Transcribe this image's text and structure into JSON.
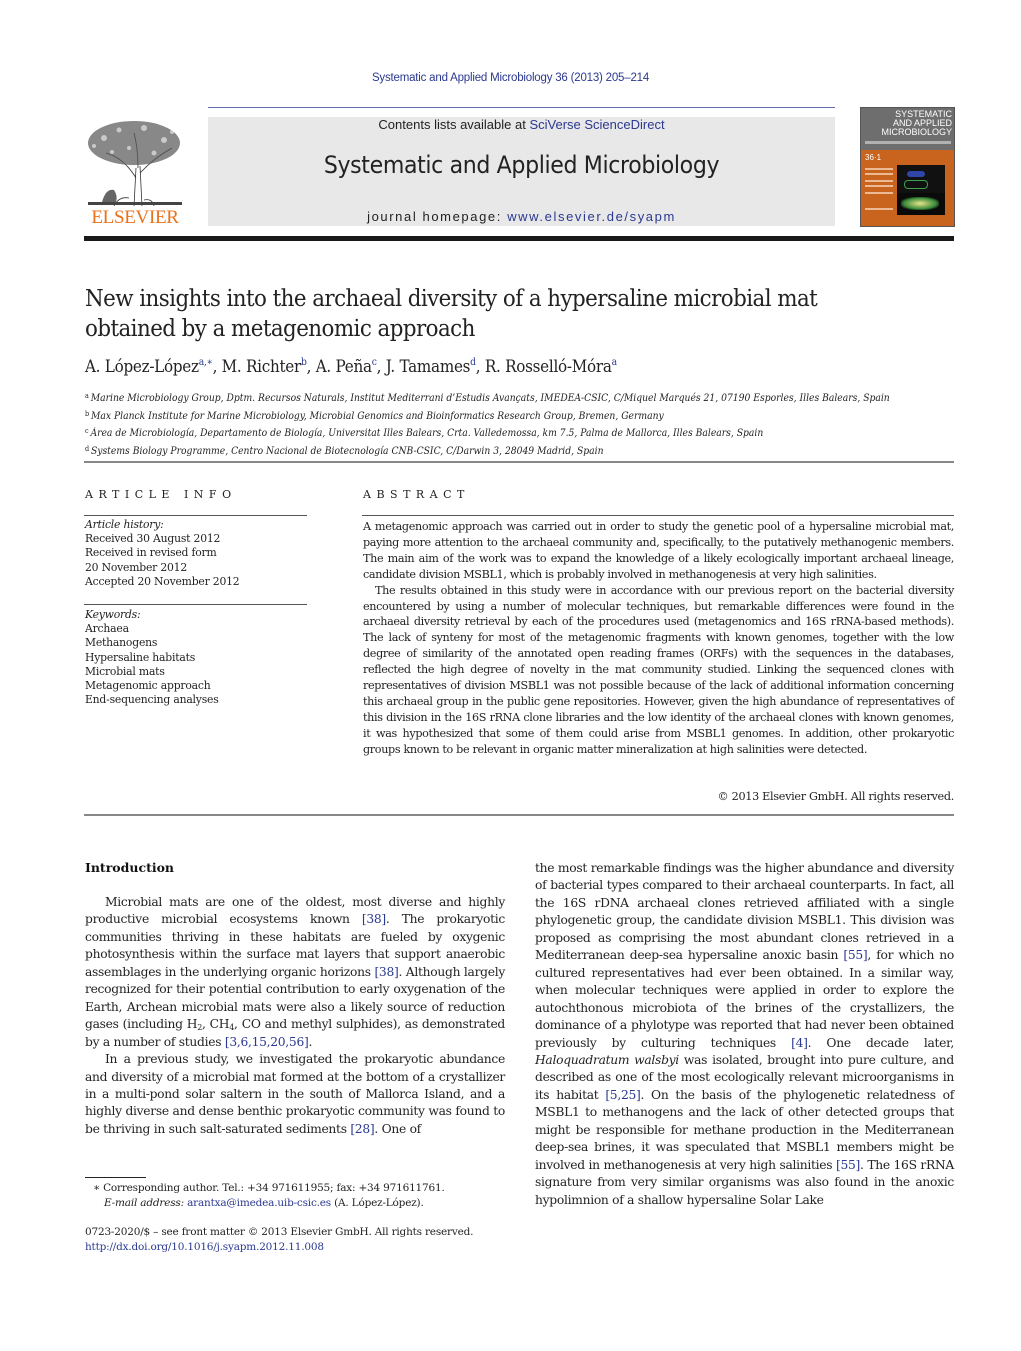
{
  "header": {
    "citation": "Systematic and Applied Microbiology 36 (2013) 205–214",
    "contents_prefix": "Contents lists available at ",
    "contents_link": "SciVerse ScienceDirect",
    "journal_title": "Systematic and Applied Microbiology",
    "homepage_prefix": "journal homepage: ",
    "homepage_link": "www.elsevier.de/syapm",
    "publisher_logo_text": "ELSEVIER",
    "cover": {
      "title_line1": "SYSTEMATIC",
      "title_line2": "AND APPLIED",
      "title_line3": "MICROBIOLOGY",
      "volume": "36·1"
    }
  },
  "article": {
    "title": "New insights into the archaeal diversity of a hypersaline microbial mat obtained by a metagenomic approach",
    "authors": [
      {
        "name": "A. López-López",
        "sup": "a,∗"
      },
      {
        "name": "M. Richter",
        "sup": "b"
      },
      {
        "name": "A. Peña",
        "sup": "c"
      },
      {
        "name": "J. Tamames",
        "sup": "d"
      },
      {
        "name": "R. Rosselló-Móra",
        "sup": "a"
      }
    ],
    "affiliations": [
      {
        "key": "a",
        "text": "Marine Microbiology Group, Dptm. Recursos Naturals, Institut Mediterrani d’Estudis Avançats, IMEDEA-CSIC, C/Miquel Marqués 21, 07190 Esporles, Illes Balears, Spain"
      },
      {
        "key": "b",
        "text": "Max Planck Institute for Marine Microbiology, Microbial Genomics and Bioinformatics Research Group, Bremen, Germany"
      },
      {
        "key": "c",
        "text": "Área de Microbiología, Departamento de Biología, Universitat Illes Balears, Crta. Valledemossa, km 7.5, Palma de Mallorca, Illes Balears, Spain"
      },
      {
        "key": "d",
        "text": "Systems Biology Programme, Centro Nacional de Biotecnología CNB-CSIC, C/Darwin 3, 28049 Madrid, Spain"
      }
    ]
  },
  "article_info": {
    "heading": "ARTICLE INFO",
    "history_label": "Article history:",
    "history": [
      "Received 30 August 2012",
      "Received in revised form",
      "20 November 2012",
      "Accepted 20 November 2012"
    ],
    "keywords_label": "Keywords:",
    "keywords": [
      "Archaea",
      "Methanogens",
      "Hypersaline habitats",
      "Microbial mats",
      "Metagenomic approach",
      "End-sequencing analyses"
    ]
  },
  "abstract": {
    "heading": "ABSTRACT",
    "paragraphs": [
      "A metagenomic approach was carried out in order to study the genetic pool of a hypersaline microbial mat, paying more attention to the archaeal community and, specifically, to the putatively methanogenic members. The main aim of the work was to expand the knowledge of a likely ecologically important archaeal lineage, candidate division MSBL1, which is probably involved in methanogenesis at very high salinities.",
      "The results obtained in this study were in accordance with our previous report on the bacterial diversity encountered by using a number of molecular techniques, but remarkable differences were found in the archaeal diversity retrieval by each of the procedures used (metagenomics and 16S rRNA-based methods). The lack of synteny for most of the metagenomic fragments with known genomes, together with the low degree of similarity of the annotated open reading frames (ORFs) with the sequences in the databases, reflected the high degree of novelty in the mat community studied. Linking the sequenced clones with representatives of division MSBL1 was not possible because of the lack of additional information concerning this archaeal group in the public gene repositories. However, given the high abundance of representatives of this division in the 16S rRNA clone libraries and the low identity of the archaeal clones with known genomes, it was hypothesized that some of them could arise from MSBL1 genomes. In addition, other prokaryotic groups known to be relevant in organic matter mineralization at high salinities were detected."
    ],
    "copyright": "© 2013 Elsevier GmbH. All rights reserved."
  },
  "introduction": {
    "heading": "Introduction",
    "left": {
      "p1_a": "Microbial mats are one of the oldest, most diverse and highly productive microbial ecosystems known ",
      "p1_ref1": "[38]",
      "p1_b": ". The prokaryotic communities thriving in these habitats are fueled by oxygenic photosynthesis within the surface mat layers that support anaerobic assemblages in the underlying organic horizons ",
      "p1_ref2": "[38]",
      "p1_c": ". Although largely recognized for their potential contribution to early oxygenation of the Earth, Archean microbial mats were also a likely source of reduction gases (including H",
      "p1_sub1": "2",
      "p1_d": ", CH",
      "p1_sub2": "4",
      "p1_e": ", CO and methyl sulphides), as demonstrated by a number of studies ",
      "p1_ref3": "[3,6,15,20,56]",
      "p1_f": ".",
      "p2_a": "In a previous study, we investigated the prokaryotic abundance and diversity of a microbial mat formed at the bottom of a crystallizer in a multi-pond solar saltern in the south of Mallorca Island, and a highly diverse and dense benthic prokaryotic community was found to be thriving in such salt-saturated sediments ",
      "p2_ref1": "[28]",
      "p2_b": ". One of"
    },
    "right": {
      "a": "the most remarkable findings was the higher abundance and diversity of bacterial types compared to their archaeal counterparts. In fact, all the 16S rDNA archaeal clones retrieved affiliated with a single phylogenetic group, the candidate division MSBL1. This division was proposed as comprising the most abundant clones retrieved in a Mediterranean deep-sea hypersaline anoxic basin ",
      "ref1": "[55]",
      "b": ", for which no cultured representatives had ever been obtained. In a similar way, when molecular techniques were applied in order to explore the autochthonous microbiota of the brines of the crystallizers, the dominance of a phylotype was reported that had never been obtained previously by culturing techniques ",
      "ref2": "[4]",
      "c": ". One decade later, ",
      "species": "Haloquadratum walsbyi",
      "d": " was isolated, brought into pure culture, and described as one of the most ecologically relevant microorganisms in its habitat ",
      "ref3": "[5,25]",
      "e": ". On the basis of the phylogenetic relatedness of MSBL1 to methanogens and the lack of other detected groups that might be responsible for methane production in the Mediterranean deep-sea brines, it was speculated that MSBL1 members might be involved in methanogenesis at very high salinities ",
      "ref4": "[55]",
      "f": ". The 16S rRNA signature from very similar organisms was also found in the anoxic hypolimnion of a shallow hypersaline Solar Lake"
    }
  },
  "footnotes": {
    "corresponding": "∗ Corresponding author. Tel.: +34 971611955; fax: +34 971611761.",
    "email_label": "E-mail address: ",
    "email": "arantxa@imedea.uib-csic.es",
    "email_suffix": " (A. López-López).",
    "front_matter": "0723-2020/$ – see front matter © 2013 Elsevier GmbH. All rights reserved.",
    "doi": "http://dx.doi.org/10.1016/j.syapm.2012.11.008"
  }
}
